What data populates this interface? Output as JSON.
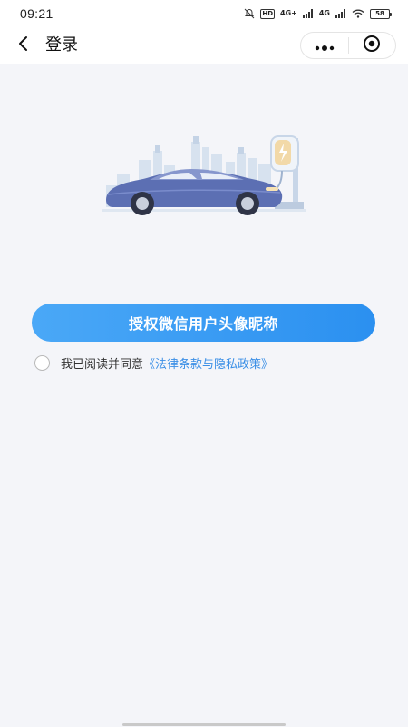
{
  "status_bar": {
    "time": "09:21",
    "hd_label": "HD",
    "sim1_label": "4G+",
    "sim2_label": "4G",
    "battery": "58"
  },
  "nav": {
    "title": "登录",
    "back_icon": "chevron-left-icon",
    "more_icon": "more-dots-icon",
    "close_icon": "target-close-icon"
  },
  "hero": {
    "image": "electric-car-charging-illustration"
  },
  "auth": {
    "button_label": "授权微信用户头像昵称"
  },
  "agreement": {
    "checked": false,
    "text": "我已阅读并同意",
    "link_text": "《法律条款与隐私政策》"
  },
  "colors": {
    "primary": "#3399f3",
    "link": "#3b8fe6",
    "background": "#f4f5f9"
  }
}
